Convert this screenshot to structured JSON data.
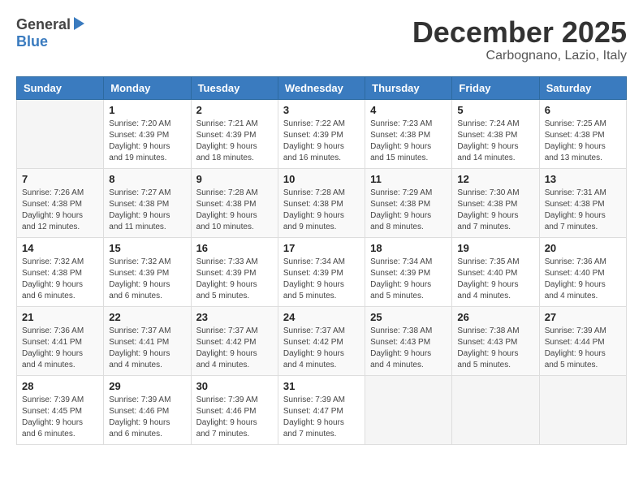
{
  "header": {
    "logo_general": "General",
    "logo_blue": "Blue",
    "month_title": "December 2025",
    "location": "Carbognano, Lazio, Italy"
  },
  "weekdays": [
    "Sunday",
    "Monday",
    "Tuesday",
    "Wednesday",
    "Thursday",
    "Friday",
    "Saturday"
  ],
  "weeks": [
    [
      {
        "day": "",
        "info": ""
      },
      {
        "day": "1",
        "info": "Sunrise: 7:20 AM\nSunset: 4:39 PM\nDaylight: 9 hours\nand 19 minutes."
      },
      {
        "day": "2",
        "info": "Sunrise: 7:21 AM\nSunset: 4:39 PM\nDaylight: 9 hours\nand 18 minutes."
      },
      {
        "day": "3",
        "info": "Sunrise: 7:22 AM\nSunset: 4:39 PM\nDaylight: 9 hours\nand 16 minutes."
      },
      {
        "day": "4",
        "info": "Sunrise: 7:23 AM\nSunset: 4:38 PM\nDaylight: 9 hours\nand 15 minutes."
      },
      {
        "day": "5",
        "info": "Sunrise: 7:24 AM\nSunset: 4:38 PM\nDaylight: 9 hours\nand 14 minutes."
      },
      {
        "day": "6",
        "info": "Sunrise: 7:25 AM\nSunset: 4:38 PM\nDaylight: 9 hours\nand 13 minutes."
      }
    ],
    [
      {
        "day": "7",
        "info": "Sunrise: 7:26 AM\nSunset: 4:38 PM\nDaylight: 9 hours\nand 12 minutes."
      },
      {
        "day": "8",
        "info": "Sunrise: 7:27 AM\nSunset: 4:38 PM\nDaylight: 9 hours\nand 11 minutes."
      },
      {
        "day": "9",
        "info": "Sunrise: 7:28 AM\nSunset: 4:38 PM\nDaylight: 9 hours\nand 10 minutes."
      },
      {
        "day": "10",
        "info": "Sunrise: 7:28 AM\nSunset: 4:38 PM\nDaylight: 9 hours\nand 9 minutes."
      },
      {
        "day": "11",
        "info": "Sunrise: 7:29 AM\nSunset: 4:38 PM\nDaylight: 9 hours\nand 8 minutes."
      },
      {
        "day": "12",
        "info": "Sunrise: 7:30 AM\nSunset: 4:38 PM\nDaylight: 9 hours\nand 7 minutes."
      },
      {
        "day": "13",
        "info": "Sunrise: 7:31 AM\nSunset: 4:38 PM\nDaylight: 9 hours\nand 7 minutes."
      }
    ],
    [
      {
        "day": "14",
        "info": "Sunrise: 7:32 AM\nSunset: 4:38 PM\nDaylight: 9 hours\nand 6 minutes."
      },
      {
        "day": "15",
        "info": "Sunrise: 7:32 AM\nSunset: 4:39 PM\nDaylight: 9 hours\nand 6 minutes."
      },
      {
        "day": "16",
        "info": "Sunrise: 7:33 AM\nSunset: 4:39 PM\nDaylight: 9 hours\nand 5 minutes."
      },
      {
        "day": "17",
        "info": "Sunrise: 7:34 AM\nSunset: 4:39 PM\nDaylight: 9 hours\nand 5 minutes."
      },
      {
        "day": "18",
        "info": "Sunrise: 7:34 AM\nSunset: 4:39 PM\nDaylight: 9 hours\nand 5 minutes."
      },
      {
        "day": "19",
        "info": "Sunrise: 7:35 AM\nSunset: 4:40 PM\nDaylight: 9 hours\nand 4 minutes."
      },
      {
        "day": "20",
        "info": "Sunrise: 7:36 AM\nSunset: 4:40 PM\nDaylight: 9 hours\nand 4 minutes."
      }
    ],
    [
      {
        "day": "21",
        "info": "Sunrise: 7:36 AM\nSunset: 4:41 PM\nDaylight: 9 hours\nand 4 minutes."
      },
      {
        "day": "22",
        "info": "Sunrise: 7:37 AM\nSunset: 4:41 PM\nDaylight: 9 hours\nand 4 minutes."
      },
      {
        "day": "23",
        "info": "Sunrise: 7:37 AM\nSunset: 4:42 PM\nDaylight: 9 hours\nand 4 minutes."
      },
      {
        "day": "24",
        "info": "Sunrise: 7:37 AM\nSunset: 4:42 PM\nDaylight: 9 hours\nand 4 minutes."
      },
      {
        "day": "25",
        "info": "Sunrise: 7:38 AM\nSunset: 4:43 PM\nDaylight: 9 hours\nand 4 minutes."
      },
      {
        "day": "26",
        "info": "Sunrise: 7:38 AM\nSunset: 4:43 PM\nDaylight: 9 hours\nand 5 minutes."
      },
      {
        "day": "27",
        "info": "Sunrise: 7:39 AM\nSunset: 4:44 PM\nDaylight: 9 hours\nand 5 minutes."
      }
    ],
    [
      {
        "day": "28",
        "info": "Sunrise: 7:39 AM\nSunset: 4:45 PM\nDaylight: 9 hours\nand 6 minutes."
      },
      {
        "day": "29",
        "info": "Sunrise: 7:39 AM\nSunset: 4:46 PM\nDaylight: 9 hours\nand 6 minutes."
      },
      {
        "day": "30",
        "info": "Sunrise: 7:39 AM\nSunset: 4:46 PM\nDaylight: 9 hours\nand 7 minutes."
      },
      {
        "day": "31",
        "info": "Sunrise: 7:39 AM\nSunset: 4:47 PM\nDaylight: 9 hours\nand 7 minutes."
      },
      {
        "day": "",
        "info": ""
      },
      {
        "day": "",
        "info": ""
      },
      {
        "day": "",
        "info": ""
      }
    ]
  ]
}
